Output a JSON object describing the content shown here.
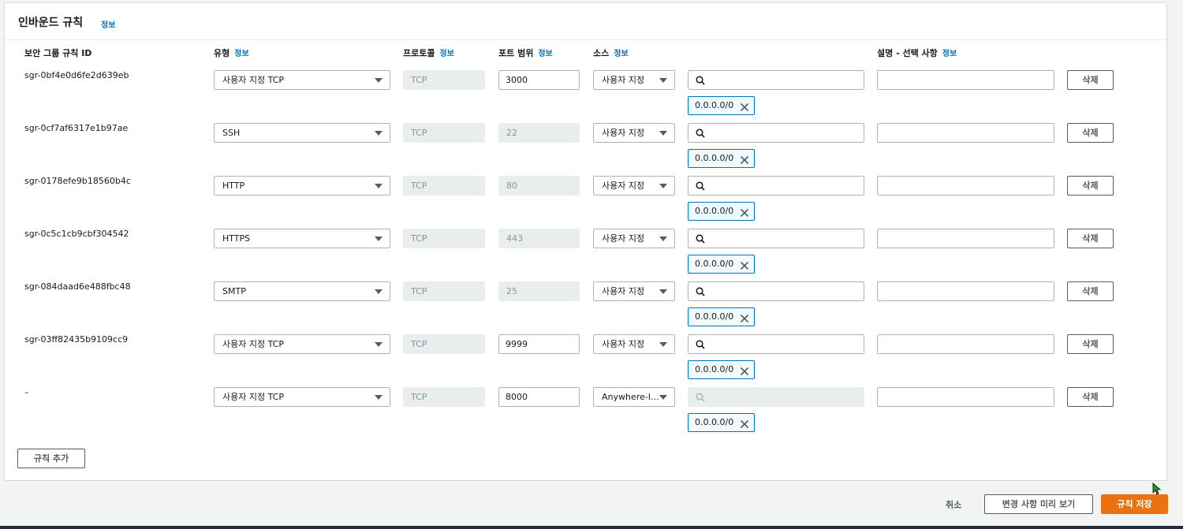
{
  "panel": {
    "title": "인바운드 규칙",
    "info_label": "정보"
  },
  "columns": {
    "rule_id": "보안 그룹 규칙 ID",
    "type": "유형",
    "protocol": "프로토콜",
    "port_range": "포트 범위",
    "source": "소스",
    "description": "설명 - 선택 사항",
    "info_label": "정보"
  },
  "rules": [
    {
      "id": "sgr-0bf4e0d6fe2d639eb",
      "type": "사용자 지정 TCP",
      "protocol": "TCP",
      "port": "3000",
      "port_editable": true,
      "source": "사용자 지정",
      "search_disabled": false,
      "cidr": "0.0.0.0/0",
      "description": "",
      "delete_label": "삭제"
    },
    {
      "id": "sgr-0cf7af6317e1b97ae",
      "type": "SSH",
      "protocol": "TCP",
      "port": "22",
      "port_editable": false,
      "source": "사용자 지정",
      "search_disabled": false,
      "cidr": "0.0.0.0/0",
      "description": "",
      "delete_label": "삭제"
    },
    {
      "id": "sgr-0178efe9b18560b4c",
      "type": "HTTP",
      "protocol": "TCP",
      "port": "80",
      "port_editable": false,
      "source": "사용자 지정",
      "search_disabled": false,
      "cidr": "0.0.0.0/0",
      "description": "",
      "delete_label": "삭제"
    },
    {
      "id": "sgr-0c5c1cb9cbf304542",
      "type": "HTTPS",
      "protocol": "TCP",
      "port": "443",
      "port_editable": false,
      "source": "사용자 지정",
      "search_disabled": false,
      "cidr": "0.0.0.0/0",
      "description": "",
      "delete_label": "삭제"
    },
    {
      "id": "sgr-084daad6e488fbc48",
      "type": "SMTP",
      "protocol": "TCP",
      "port": "25",
      "port_editable": false,
      "source": "사용자 지정",
      "search_disabled": false,
      "cidr": "0.0.0.0/0",
      "description": "",
      "delete_label": "삭제"
    },
    {
      "id": "sgr-03ff82435b9109cc9",
      "type": "사용자 지정 TCP",
      "protocol": "TCP",
      "port": "9999",
      "port_editable": true,
      "source": "사용자 지정",
      "search_disabled": false,
      "cidr": "0.0.0.0/0",
      "description": "",
      "delete_label": "삭제"
    },
    {
      "id": "–",
      "type": "사용자 지정 TCP",
      "protocol": "TCP",
      "port": "8000",
      "port_editable": true,
      "source": "Anywhere-I...",
      "search_disabled": true,
      "cidr": "0.0.0.0/0",
      "description": "",
      "delete_label": "삭제"
    }
  ],
  "add_rule_label": "규칙 추가",
  "footer": {
    "cancel_label": "취소",
    "preview_label": "변경 사항 미리 보기",
    "save_label": "규칙 저장"
  },
  "colors": {
    "accent": "#ec7211",
    "link": "#0073bb",
    "token_border": "#0073bb"
  }
}
